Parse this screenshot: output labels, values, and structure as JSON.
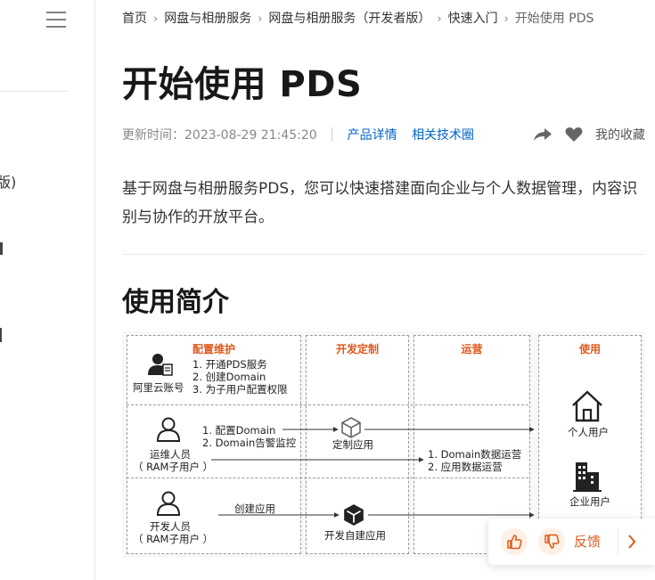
{
  "sidebar": {
    "fragments": [
      "版)"
    ]
  },
  "breadcrumb": {
    "items": [
      "首页",
      "网盘与相册服务",
      "网盘与相册服务（开发者版）",
      "快速入门"
    ],
    "current": "开始使用 PDS"
  },
  "page": {
    "title": "开始使用 PDS",
    "updated_label": "更新时间：",
    "updated_time": "2023-08-29 21:45:20",
    "links": [
      "产品详情",
      "相关技术圈"
    ],
    "favorite_label": "我的收藏",
    "intro": "基于网盘与相册服务PDS，您可以快速搭建面向企业与个人数据管理，内容识别与协作的开放平台。",
    "section_heading": "使用简介"
  },
  "diagram": {
    "zones": [
      "配置维护",
      "开发定制",
      "运营",
      "使用"
    ],
    "actors": {
      "aliyun": "阿里云账号",
      "ops_line1": "运维人员",
      "ops_line2": "（ RAM子用户 ）",
      "dev_line1": "开发人员",
      "dev_line2": "（ RAM子用户 ）"
    },
    "aliyun_steps": [
      "1. 开通PDS服务",
      "2. 创建Domain",
      "3. 为子用户配置权限"
    ],
    "ops_steps": [
      "1. 配置Domain",
      "2. Domain告警监控"
    ],
    "dev_action": "创建应用",
    "custom_app": "定制应用",
    "self_app": "开发自建应用",
    "operations": [
      "1. Domain数据运营",
      "2. 应用数据运营"
    ],
    "personal_user": "个人用户",
    "enterprise_user": "企业用户",
    "accent_color": "#e0581b"
  },
  "feedback": {
    "label": "反馈",
    "icons": [
      "thumbs-up-icon",
      "thumbs-down-icon",
      "chevron-right-icon"
    ]
  },
  "colors": {
    "link": "#0064c8",
    "accent": "#e0581b"
  }
}
